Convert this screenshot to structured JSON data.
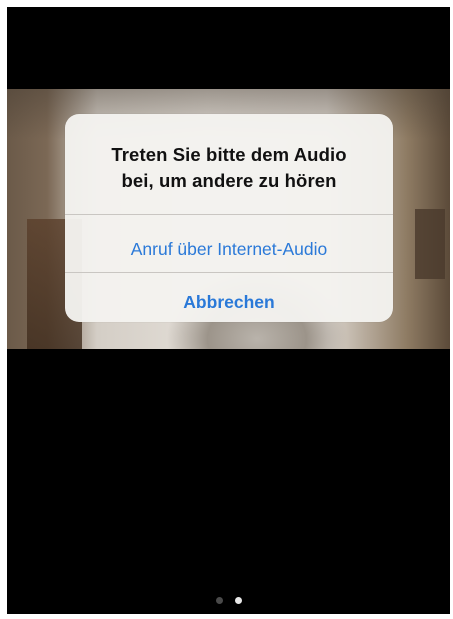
{
  "alert": {
    "title_line1": "Treten Sie bitte dem Audio",
    "title_line2": "bei, um andere zu hören",
    "primary_action": "Anruf über Internet-Audio",
    "cancel_action": "Abbrechen"
  },
  "pager": {
    "count": 2,
    "active_index": 1
  },
  "colors": {
    "accent": "#2a79d8",
    "alert_bg": "#f4f2ef",
    "screen_bg": "#000000"
  }
}
